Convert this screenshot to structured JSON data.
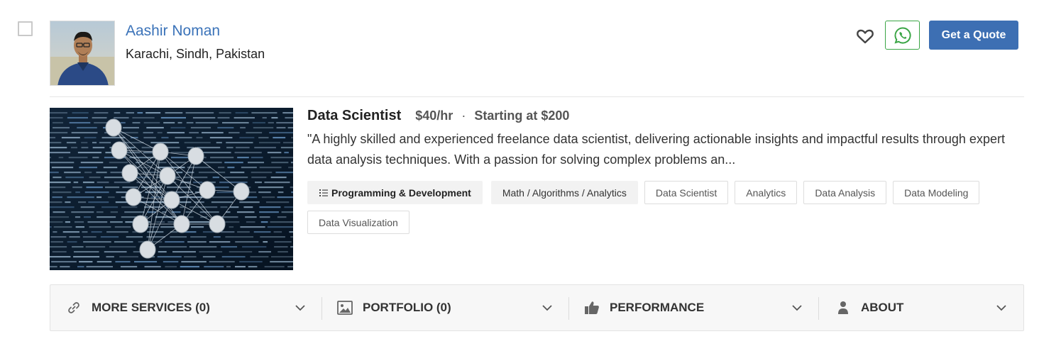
{
  "profile": {
    "name": "Aashir Noman",
    "location": "Karachi, Sindh, Pakistan",
    "avatar_icon": "user-photo"
  },
  "actions": {
    "favorite_icon": "heart-outline-icon",
    "whatsapp_icon": "whatsapp-icon",
    "quote_label": "Get a Quote"
  },
  "service": {
    "image_icon": "neural-network-illustration",
    "title": "Data Scientist",
    "rate": "$40/hr",
    "separator": "·",
    "starting": "Starting at $200",
    "description": "\"A highly skilled and experienced freelance data scientist, delivering actionable insights and impactful results through expert data analysis techniques. With a passion for solving complex problems an...",
    "tags": [
      {
        "label": "Programming & Development",
        "kind": "category"
      },
      {
        "label": "Math / Algorithms / Analytics",
        "kind": "subcategory"
      },
      {
        "label": "Data Scientist",
        "kind": "skill"
      },
      {
        "label": "Analytics",
        "kind": "skill"
      },
      {
        "label": "Data Analysis",
        "kind": "skill"
      },
      {
        "label": "Data Modeling",
        "kind": "skill"
      },
      {
        "label": "Data Visualization",
        "kind": "skill"
      }
    ]
  },
  "sections": [
    {
      "label": "MORE SERVICES (0)",
      "icon": "link-icon"
    },
    {
      "label": "PORTFOLIO (0)",
      "icon": "image-icon"
    },
    {
      "label": "PERFORMANCE",
      "icon": "thumbs-up-icon"
    },
    {
      "label": "ABOUT",
      "icon": "user-icon"
    }
  ],
  "colors": {
    "accent": "#3d6fb3",
    "link": "#3b73b9",
    "whatsapp": "#3aa545"
  }
}
